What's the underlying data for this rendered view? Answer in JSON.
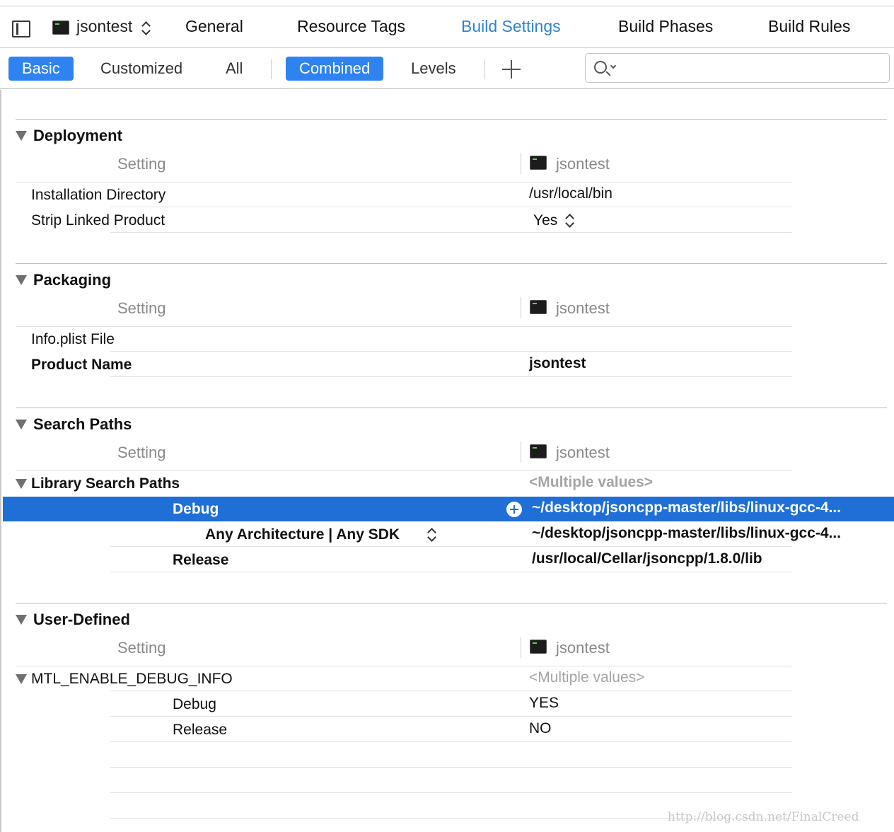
{
  "tabbar": {
    "target": "jsontest",
    "tabs": [
      "General",
      "Resource Tags",
      "Build Settings",
      "Build Phases",
      "Build Rules"
    ],
    "active_tab": "Build Settings",
    "accent_color": "#2f83d4"
  },
  "filterbar": {
    "scope": [
      "Basic",
      "Customized",
      "All"
    ],
    "scope_selected": "Basic",
    "view": [
      "Combined",
      "Levels"
    ],
    "view_selected": "Combined",
    "search_placeholder": ""
  },
  "sections": {
    "deployment": {
      "title": "Deployment",
      "header_setting": "Setting",
      "header_target": "jsontest",
      "rows": [
        {
          "label": "Installation Directory",
          "value": "/usr/local/bin"
        },
        {
          "label": "Strip Linked Product",
          "value": "Yes"
        }
      ]
    },
    "packaging": {
      "title": "Packaging",
      "header_setting": "Setting",
      "header_target": "jsontest",
      "rows": [
        {
          "label": "Info.plist File",
          "value": ""
        },
        {
          "label": "Product Name",
          "value": "jsontest"
        }
      ]
    },
    "search_paths": {
      "title": "Search Paths",
      "header_setting": "Setting",
      "header_target": "jsontest",
      "library": {
        "label": "Library Search Paths",
        "value": "<Multiple values>",
        "debug_label": "Debug",
        "debug_value": "~/desktop/jsoncpp-master/libs/linux-gcc-4...",
        "arch_label": "Any Architecture | Any SDK",
        "arch_value": "~/desktop/jsoncpp-master/libs/linux-gcc-4...",
        "release_label": "Release",
        "release_value": "/usr/local/Cellar/jsoncpp/1.8.0/lib"
      }
    },
    "user_defined": {
      "title": "User-Defined",
      "header_setting": "Setting",
      "header_target": "jsontest",
      "mtl": {
        "label": "MTL_ENABLE_DEBUG_INFO",
        "value": "<Multiple values>",
        "debug_label": "Debug",
        "debug_value": "YES",
        "release_label": "Release",
        "release_value": "NO"
      }
    }
  },
  "watermark": "http://blog.csdn.net/FinalCreed",
  "selection_color": "#1f6fd6"
}
